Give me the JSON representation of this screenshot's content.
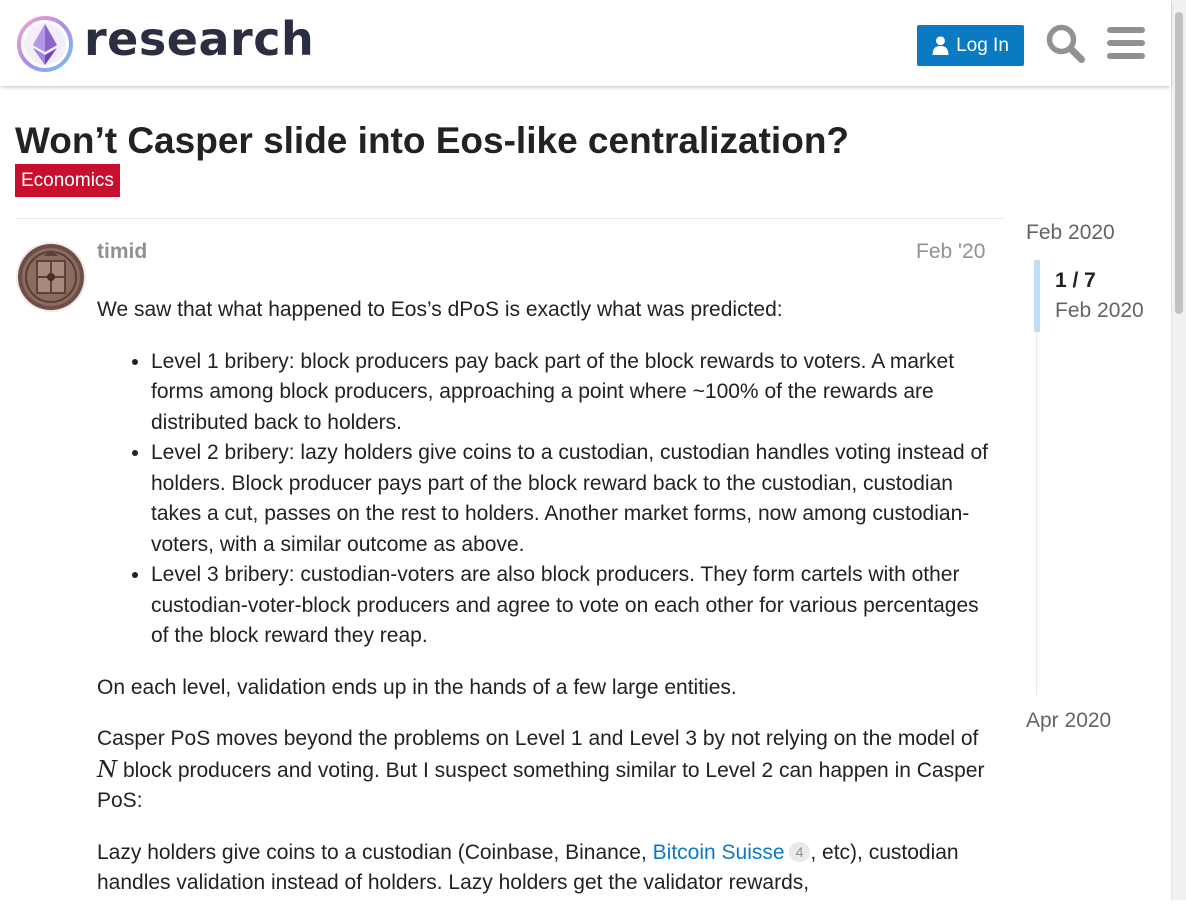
{
  "header": {
    "logo_text": "research",
    "login_label": "Log In",
    "icons": [
      "logo-icon",
      "user-icon",
      "search-icon",
      "hamburger-menu-icon"
    ],
    "accent_color": "#0a7ac2"
  },
  "topic": {
    "title": "Won’t Casper slide into Eos-like centralization?",
    "category": "Economics",
    "category_color": "#c8102e"
  },
  "post": {
    "username": "timid",
    "date": "Feb '20",
    "intro": "We saw that what happened to Eos’s dPoS is exactly what was predicted:",
    "bullets": [
      "Level 1 bribery: block producers pay back part of the block rewards to voters. A market forms among block producers, approaching a point where ~100% of the rewards are distributed back to holders.",
      "Level 2 bribery: lazy holders give coins to a custodian, custodian handles voting instead of holders. Block producer pays part of the block reward back to the custodian, custodian takes a cut, passes on the rest to holders. Another market forms, now among custodian-voters, with a similar outcome as above.",
      "Level 3 bribery: custodian-voters are also block producers. They form cartels with other custodian-voter-block producers and agree to vote on each other for various percentages of the block reward they reap."
    ],
    "para2": "On each level, validation ends up in the hands of a few large entities.",
    "para3_a": "Casper PoS moves beyond the problems on Level 1 and Level 3 by not relying on the model of ",
    "para3_math": "N",
    "para3_b": " block producers and voting. But I suspect something similar to Level 2 can happen in Casper PoS:",
    "para4_a": "Lazy holders give coins to a custodian (Coinbase, Binance, ",
    "para4_link": "Bitcoin Suisse",
    "para4_clicks": "4",
    "para4_b": ", etc), custodian handles validation instead of holders. Lazy holders get the validator rewards,"
  },
  "timeline": {
    "start": "Feb 2020",
    "position": "1 / 7",
    "current_date": "Feb 2020",
    "end": "Apr 2020"
  }
}
